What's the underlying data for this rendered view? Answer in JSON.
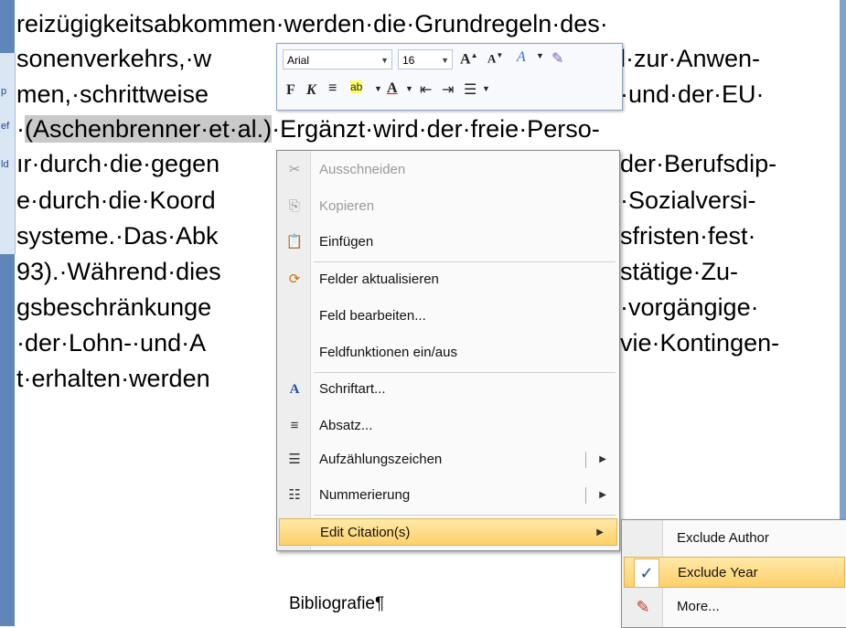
{
  "nav_fragments": [
    "p",
    "ef",
    "ld"
  ],
  "document": {
    "lines": [
      {
        "pre": "reizügigkeitsabkommen·werden·die·Grundregeln·des·",
        "hl": "",
        "post": ""
      },
      {
        "pre": "sonenverkehrs,·w",
        "hl": "",
        "post": "",
        "tail": "l·zur·Anwen-"
      },
      {
        "pre": "men,·schrittweise",
        "hl": "",
        "post": "",
        "tail": "·und·der·EU·"
      },
      {
        "pre": "·",
        "hl": "(Aschenbrenner·et·al.)",
        "post": "·Ergänzt·wird·der·freie·Perso-"
      },
      {
        "pre": "ır·durch·die·gegen",
        "hl": "",
        "post": "",
        "tail": "der·Berufsdip-"
      },
      {
        "pre": "e·durch·die·Koord",
        "hl": "",
        "post": "",
        "tail": "·Sozialversi-"
      },
      {
        "pre": "systeme.·Das·Abk",
        "hl": "",
        "post": "",
        "tail": "sfristen·fest·"
      },
      {
        "pre": "93).·Während·dies",
        "hl": "",
        "post": "",
        "tail": "stätige·Zu-"
      },
      {
        "pre": "gsbeschränkunge",
        "hl": "",
        "post": "",
        "tail": "·vorgängige·"
      },
      {
        "pre": "·der·Lohn-·und·A",
        "hl": "",
        "post": "",
        "tail": "vie·Kontingen-"
      },
      {
        "pre": "t·erhalten·werden",
        "hl": "",
        "post": "",
        "tail": ""
      }
    ],
    "bibliography_heading": "Bibliografie¶"
  },
  "mini_toolbar": {
    "font_name": "Arial",
    "font_size": "16",
    "bold": "F",
    "italic": "K"
  },
  "context_menu": {
    "items": [
      {
        "label": "Ausschneiden",
        "icon": "scissors-icon",
        "glyph": "✂",
        "disabled": true
      },
      {
        "label": "Kopieren",
        "icon": "copy-icon",
        "glyph": "⎘",
        "disabled": true
      },
      {
        "label": "Einfügen",
        "icon": "paste-icon",
        "glyph": "📋",
        "disabled": false
      },
      {
        "label": "Felder aktualisieren",
        "icon": "update-fields-icon",
        "glyph": "⟳",
        "disabled": false
      },
      {
        "label": "Feld bearbeiten...",
        "icon": "",
        "glyph": "",
        "disabled": false
      },
      {
        "label": "Feldfunktionen ein/aus",
        "icon": "",
        "glyph": "",
        "disabled": false
      },
      {
        "label": "Schriftart...",
        "icon": "font-icon",
        "glyph": "A",
        "disabled": false
      },
      {
        "label": "Absatz...",
        "icon": "paragraph-icon",
        "glyph": "≡",
        "disabled": false
      },
      {
        "label": "Aufzählungszeichen",
        "icon": "bullets-icon",
        "glyph": "☰",
        "disabled": false,
        "submenu": true
      },
      {
        "label": "Nummerierung",
        "icon": "numbering-icon",
        "glyph": "☷",
        "disabled": false,
        "submenu": true
      },
      {
        "label": "Edit Citation(s)",
        "icon": "",
        "glyph": "",
        "disabled": false,
        "submenu": true,
        "active": true
      }
    ]
  },
  "submenu": {
    "items": [
      {
        "label": "Exclude Author",
        "checked": false
      },
      {
        "label": "Exclude Year",
        "checked": true
      },
      {
        "label": "More...",
        "checked": false
      }
    ]
  },
  "colors": {
    "highlight": "#ffd06a",
    "sidebar": "#5f86b8"
  }
}
